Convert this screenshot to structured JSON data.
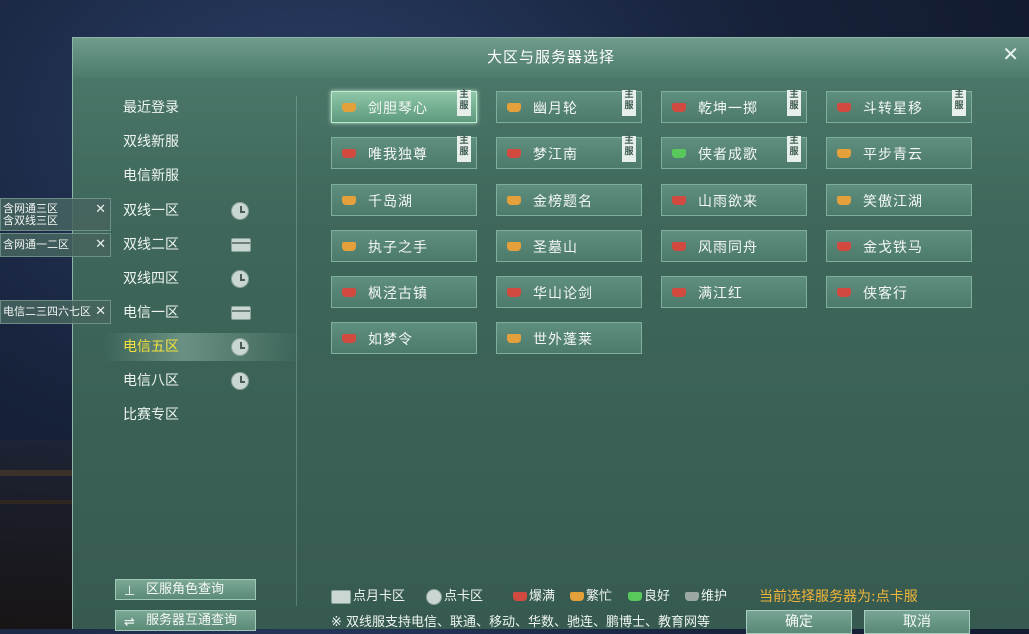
{
  "dialog": {
    "title": "大区与服务器选择",
    "close_symbol": "✕"
  },
  "sidebar": {
    "items": [
      {
        "label": "最近登录",
        "icon": ""
      },
      {
        "label": "双线新服",
        "icon": ""
      },
      {
        "label": "电信新服",
        "icon": ""
      },
      {
        "label": "双线一区",
        "icon": "clock-icon"
      },
      {
        "label": "双线二区",
        "icon": "card-icon"
      },
      {
        "label": "双线四区",
        "icon": "clock-icon"
      },
      {
        "label": "电信一区",
        "icon": "card-icon"
      },
      {
        "label": "电信五区",
        "icon": "clock-icon",
        "active": true
      },
      {
        "label": "电信八区",
        "icon": "clock-icon"
      },
      {
        "label": "比赛专区",
        "icon": ""
      }
    ],
    "buttons": {
      "role_query": "区服角色查询",
      "interop_query": "服务器互通查询"
    }
  },
  "tags": [
    {
      "line1": "含网通三区",
      "line2": "含双线三区"
    },
    {
      "line1": "含网通一二区",
      "line2": ""
    },
    {
      "line1": "电信二三四六七区",
      "line2": ""
    }
  ],
  "servers": [
    {
      "name": "剑胆琴心",
      "status": "orange",
      "main": true,
      "selected": true
    },
    {
      "name": "幽月轮",
      "status": "orange",
      "main": true
    },
    {
      "name": "乾坤一掷",
      "status": "red",
      "main": true
    },
    {
      "name": "斗转星移",
      "status": "red",
      "main": true
    },
    {
      "name": "唯我独尊",
      "status": "red",
      "main": true
    },
    {
      "name": "梦江南",
      "status": "red",
      "main": true
    },
    {
      "name": "侠者成歌",
      "status": "green",
      "main": true
    },
    {
      "name": "平步青云",
      "status": "orange",
      "main": false
    },
    {
      "name": "千岛湖",
      "status": "orange",
      "main": false
    },
    {
      "name": "金榜题名",
      "status": "orange",
      "main": false
    },
    {
      "name": "山雨欲来",
      "status": "red",
      "main": false
    },
    {
      "name": "笑傲江湖",
      "status": "orange",
      "main": false
    },
    {
      "name": "执子之手",
      "status": "orange",
      "main": false
    },
    {
      "name": "圣墓山",
      "status": "orange",
      "main": false
    },
    {
      "name": "风雨同舟",
      "status": "red",
      "main": false
    },
    {
      "name": "金戈铁马",
      "status": "red",
      "main": false
    },
    {
      "name": "枫泾古镇",
      "status": "red",
      "main": false
    },
    {
      "name": "华山论剑",
      "status": "red",
      "main": false
    },
    {
      "name": "满江红",
      "status": "red",
      "main": false
    },
    {
      "name": "侠客行",
      "status": "red",
      "main": false
    },
    {
      "name": "如梦令",
      "status": "red",
      "main": false
    },
    {
      "name": "世外蓬莱",
      "status": "orange",
      "main": false
    }
  ],
  "main_badge": "主服",
  "legend": {
    "card_zone": "点月卡区",
    "clock_zone": "点卡区",
    "full": "爆满",
    "busy": "繁忙",
    "good": "良好",
    "maintenance": "维护"
  },
  "status_colors": {
    "red": "#d24a3f",
    "orange": "#e3a03b",
    "green": "#58c95a",
    "gray": "#9ba7a3"
  },
  "current_selection": "当前选择服务器为:点卡服",
  "note": "※ 双线服支持电信、联通、移动、华数、驰连、鹏博士、教育网等",
  "buttons": {
    "confirm": "确定",
    "cancel": "取消"
  }
}
